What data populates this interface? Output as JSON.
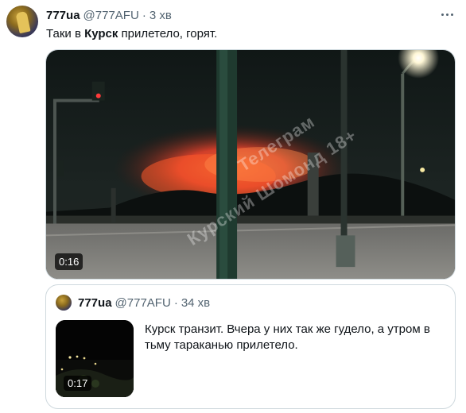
{
  "tweet": {
    "display_name": "777ua",
    "handle": "@777AFU",
    "separator": "·",
    "time": "3 хв",
    "text_before": "Таки в ",
    "text_bold": "Курск",
    "text_after": " прилетело, горят.",
    "more_icon": "more-horizontal-icon"
  },
  "video": {
    "duration": "0:16",
    "watermark_line1": "Телеграм",
    "watermark_line2": "Курский Шомонд 18+"
  },
  "quoted_tweet": {
    "display_name": "777ua",
    "handle": "@777AFU",
    "separator": "·",
    "time": "34 хв",
    "text": "Курск транзит. Вчера у них так же гудело, а утром в тьму тараканью прилетело.",
    "video_duration": "0:17"
  },
  "colors": {
    "text": "#0f1419",
    "secondary_text": "#536471",
    "border": "#cfd9de",
    "fire": "#ff5a2a"
  }
}
